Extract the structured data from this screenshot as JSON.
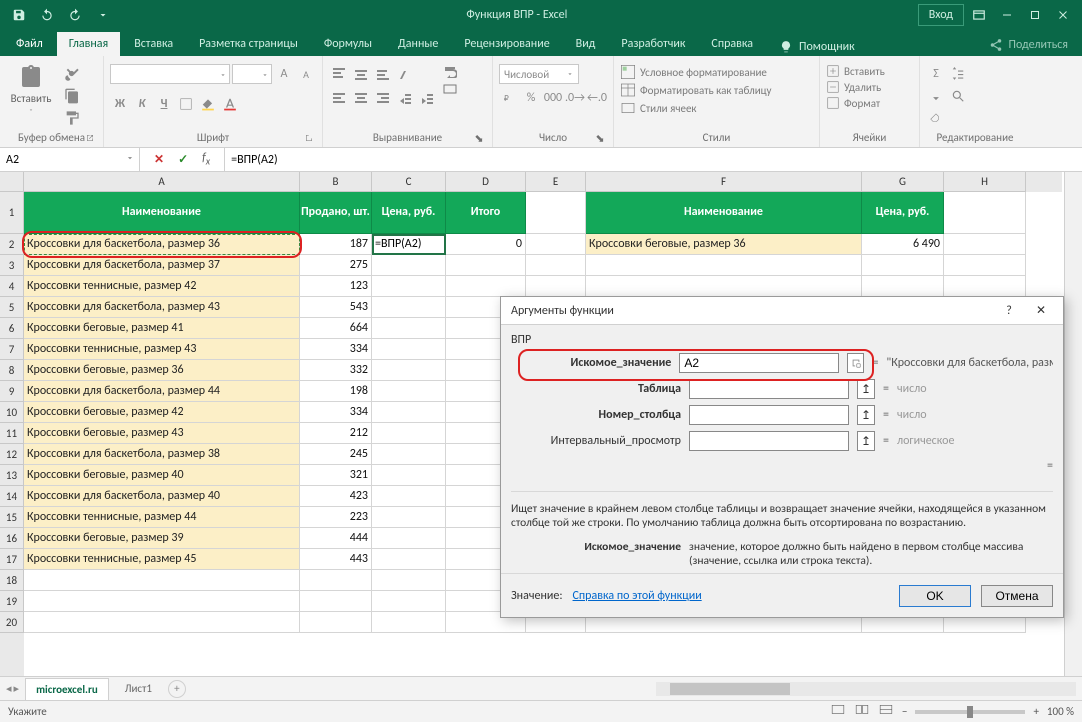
{
  "titlebar": {
    "title": "Функция ВПР  -  Excel",
    "login": "Вход"
  },
  "tabs": [
    "Файл",
    "Главная",
    "Вставка",
    "Разметка страницы",
    "Формулы",
    "Данные",
    "Рецензирование",
    "Вид",
    "Разработчик",
    "Справка",
    "Помощник",
    "Поделиться"
  ],
  "ribbon": {
    "clipboard": {
      "paste": "Вставить",
      "label": "Буфер обмена"
    },
    "font": {
      "label": "Шрифт",
      "b": "Ж",
      "i": "К",
      "u": "Ч"
    },
    "align": {
      "label": "Выравнивание"
    },
    "number": {
      "sel": "Числовой",
      "label": "Число"
    },
    "styles": {
      "cond": "Условное форматирование",
      "table": "Форматировать как таблицу",
      "cell": "Стили ячеек",
      "label": "Стили"
    },
    "cells": {
      "ins": "Вставить",
      "del": "Удалить",
      "fmt": "Формат",
      "label": "Ячейки"
    },
    "editing": {
      "label": "Редактирование"
    }
  },
  "formula_bar": {
    "name": "A2",
    "formula": "=ВПР(A2)"
  },
  "columns": {
    "A": 276,
    "B": 72,
    "C": 74,
    "D": 80,
    "E": 60,
    "F": 276,
    "G": 82,
    "H": 82
  },
  "headers_left": {
    "A": "Наименование",
    "B": "Продано, шт.",
    "C": "Цена, руб.",
    "D": "Итого"
  },
  "headers_right": {
    "F": "Наименование",
    "G": "Цена, руб."
  },
  "rows_left": [
    {
      "n": "Кроссовки для баскетбола, размер 36",
      "q": "187",
      "c": "=ВПР(A2)",
      "t": "0"
    },
    {
      "n": "Кроссовки для баскетбола, размер 37",
      "q": "275"
    },
    {
      "n": "Кроссовки теннисные, размер 42",
      "q": "123"
    },
    {
      "n": "Кроссовки для баскетбола, размер 43",
      "q": "543"
    },
    {
      "n": "Кроссовки беговые, размер 41",
      "q": "664"
    },
    {
      "n": "Кроссовки теннисные, размер 43",
      "q": "334"
    },
    {
      "n": "Кроссовки беговые, размер 36",
      "q": "332"
    },
    {
      "n": "Кроссовки для баскетбола, размер 44",
      "q": "198"
    },
    {
      "n": "Кроссовки беговые, размер 42",
      "q": "334"
    },
    {
      "n": "Кроссовки беговые, размер 43",
      "q": "212"
    },
    {
      "n": "Кроссовки для баскетбола, размер 38",
      "q": "245"
    },
    {
      "n": "Кроссовки беговые, размер 40",
      "q": "321"
    },
    {
      "n": "Кроссовки для баскетбола, размер 40",
      "q": "423"
    },
    {
      "n": "Кроссовки теннисные, размер 44",
      "q": "223"
    },
    {
      "n": "Кроссовки беговые, размер 39",
      "q": "444"
    },
    {
      "n": "Кроссовки теннисные, размер 45",
      "q": "443"
    }
  ],
  "rows_right": [
    {
      "n": "Кроссовки беговые, размер 36",
      "p": "6 490"
    }
  ],
  "sheet_tabs": {
    "active": "microexcel.ru",
    "other": "Лист1"
  },
  "statusbar": {
    "left": "Укажите",
    "zoom": "100 %"
  },
  "dialog": {
    "title": "Аргументы функции",
    "fn": "ВПР",
    "args": [
      {
        "label": "Искомое_значение",
        "value": "A2",
        "preview": "\"Кроссовки для баскетбола, разме"
      },
      {
        "label": "Таблица",
        "value": "",
        "preview": "число"
      },
      {
        "label": "Номер_столбца",
        "value": "",
        "preview": "число"
      },
      {
        "label": "Интервальный_просмотр",
        "value": "",
        "preview": "логическое"
      }
    ],
    "result_eq": "=",
    "desc": "Ищет значение в крайнем левом столбце таблицы и возвращает значение ячейки, находящейся в указанном столбце той же строки. По умолчанию таблица должна быть отсортирована по возрастанию.",
    "arg_desc_k": "Искомое_значение",
    "arg_desc_v": "значение, которое должно быть найдено в первом столбце массива (значение, ссылка или строка текста).",
    "result_label": "Значение:",
    "help": "Справка по этой функции",
    "ok": "OK",
    "cancel": "Отмена"
  }
}
